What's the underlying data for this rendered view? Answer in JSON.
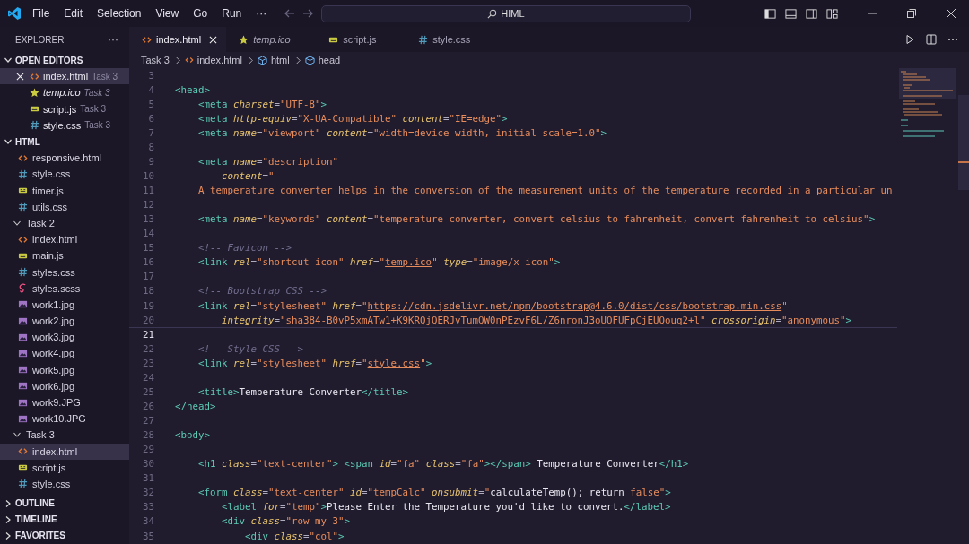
{
  "title_bar": {
    "menu": [
      "File",
      "Edit",
      "Selection",
      "View",
      "Go",
      "Run",
      "···"
    ],
    "search": "HIML"
  },
  "sidebar": {
    "title": "EXPLORER",
    "more": "···",
    "open_editors": {
      "label": "OPEN EDITORS",
      "expanded": true,
      "items": [
        {
          "name": "index.html",
          "kind": "html",
          "description": "Task 3",
          "selected": true,
          "preview": false
        },
        {
          "name": "temp.ico",
          "kind": "ico",
          "description": "Task 3",
          "selected": false,
          "preview": true
        },
        {
          "name": "script.js",
          "kind": "js",
          "description": "Task 3",
          "selected": false,
          "preview": false
        },
        {
          "name": "style.css",
          "kind": "css",
          "description": "Task 3",
          "selected": false,
          "preview": false
        }
      ]
    },
    "folder": {
      "label": "HTML",
      "expanded": true,
      "items": [
        {
          "name": "responsive.html",
          "kind": "html",
          "selected": false
        },
        {
          "name": "style.css",
          "kind": "css",
          "selected": false
        },
        {
          "name": "timer.js",
          "kind": "js",
          "selected": false
        },
        {
          "name": "utils.css",
          "kind": "css",
          "selected": false
        },
        {
          "name": "Task 2",
          "kind": "folder",
          "expanded": true,
          "selected": false,
          "children": [
            {
              "name": "index.html",
              "kind": "html",
              "selected": false
            },
            {
              "name": "main.js",
              "kind": "js",
              "selected": false
            },
            {
              "name": "styles.css",
              "kind": "css",
              "selected": false
            },
            {
              "name": "styles.scss",
              "kind": "scss",
              "selected": false
            },
            {
              "name": "work1.jpg",
              "kind": "image",
              "selected": false
            },
            {
              "name": "work2.jpg",
              "kind": "image",
              "selected": false
            },
            {
              "name": "work3.jpg",
              "kind": "image",
              "selected": false
            },
            {
              "name": "work4.jpg",
              "kind": "image",
              "selected": false
            },
            {
              "name": "work5.jpg",
              "kind": "image",
              "selected": false
            },
            {
              "name": "work6.jpg",
              "kind": "image",
              "selected": false
            },
            {
              "name": "work9.JPG",
              "kind": "image",
              "selected": false
            },
            {
              "name": "work10.JPG",
              "kind": "image",
              "selected": false
            }
          ]
        },
        {
          "name": "Task 3",
          "kind": "folder",
          "expanded": true,
          "selected": false,
          "children": [
            {
              "name": "index.html",
              "kind": "html",
              "selected": true
            },
            {
              "name": "script.js",
              "kind": "js",
              "selected": false
            },
            {
              "name": "style.css",
              "kind": "css",
              "selected": false
            }
          ]
        }
      ]
    },
    "sections": [
      {
        "label": "OUTLINE",
        "expanded": false
      },
      {
        "label": "TIMELINE",
        "expanded": false
      },
      {
        "label": "FAVORITES",
        "expanded": false
      }
    ]
  },
  "tabs": [
    {
      "label": "index.html",
      "kind": "html",
      "selected": true,
      "preview": false
    },
    {
      "label": "temp.ico",
      "kind": "ico",
      "selected": false,
      "preview": true
    },
    {
      "label": "script.js",
      "kind": "js",
      "selected": false,
      "preview": false
    },
    {
      "label": "style.css",
      "kind": "css",
      "selected": false,
      "preview": false
    }
  ],
  "breadcrumbs": [
    {
      "label": "Task 3",
      "kind": "folder"
    },
    {
      "label": "index.html",
      "kind": "html"
    },
    {
      "label": "html",
      "kind": "element"
    },
    {
      "label": "head",
      "kind": "element"
    }
  ],
  "editor": {
    "lines": [
      {
        "number": "3"
      },
      {
        "number": "4",
        "tokens": [
          {
            "kind": "tag",
            "text": "<head>"
          }
        ]
      },
      {
        "number": "5",
        "tokens": [
          {
            "kind": "tag",
            "text": "    <meta "
          },
          {
            "kind": "attr",
            "text": "charset"
          },
          {
            "kind": "punct",
            "text": "="
          },
          {
            "kind": "str",
            "text": "\"UTF-8\""
          },
          {
            "kind": "tag",
            "text": ">"
          }
        ]
      },
      {
        "number": "6",
        "tokens": [
          {
            "kind": "tag",
            "text": "    <meta "
          },
          {
            "kind": "attr",
            "text": "http-equiv"
          },
          {
            "kind": "punct",
            "text": "="
          },
          {
            "kind": "str",
            "text": "\"X-UA-Compatible\" "
          },
          {
            "kind": "attr",
            "text": "content"
          },
          {
            "kind": "punct",
            "text": "="
          },
          {
            "kind": "str",
            "text": "\"IE=edge\""
          },
          {
            "kind": "tag",
            "text": ">"
          }
        ]
      },
      {
        "number": "7",
        "tokens": [
          {
            "kind": "tag",
            "text": "    <meta "
          },
          {
            "kind": "attr",
            "text": "name"
          },
          {
            "kind": "punct",
            "text": "="
          },
          {
            "kind": "str",
            "text": "\"viewport\" "
          },
          {
            "kind": "attr",
            "text": "content"
          },
          {
            "kind": "punct",
            "text": "="
          },
          {
            "kind": "str",
            "text": "\"width=device-width, initial-scale=1.0\""
          },
          {
            "kind": "tag",
            "text": ">"
          }
        ]
      },
      {
        "number": "8"
      },
      {
        "number": "9",
        "tokens": [
          {
            "kind": "tag",
            "text": "    <meta "
          },
          {
            "kind": "attr",
            "text": "name"
          },
          {
            "kind": "punct",
            "text": "="
          },
          {
            "kind": "str",
            "text": "\"description\""
          }
        ]
      },
      {
        "number": "10",
        "tokens": [
          {
            "kind": "attr",
            "text": "        content"
          },
          {
            "kind": "punct",
            "text": "="
          },
          {
            "kind": "str",
            "text": "\""
          }
        ]
      },
      {
        "number": "11",
        "tokens": [
          {
            "kind": "str",
            "text": "    A temperature converter helps in the conversion of the measurement units of the temperature recorded in a particular un"
          }
        ]
      },
      {
        "number": "12"
      },
      {
        "number": "13",
        "tokens": [
          {
            "kind": "tag",
            "text": "    <meta "
          },
          {
            "kind": "attr",
            "text": "name"
          },
          {
            "kind": "punct",
            "text": "="
          },
          {
            "kind": "str",
            "text": "\"keywords\" "
          },
          {
            "kind": "attr",
            "text": "content"
          },
          {
            "kind": "punct",
            "text": "="
          },
          {
            "kind": "str",
            "text": "\"temperature converter, convert celsius to fahrenheit, convert fahrenheit to celsius\""
          },
          {
            "kind": "tag",
            "text": ">"
          }
        ]
      },
      {
        "number": "14"
      },
      {
        "number": "15",
        "tokens": [
          {
            "kind": "comment",
            "text": "    <!-- Favicon -->"
          }
        ]
      },
      {
        "number": "16",
        "tokens": [
          {
            "kind": "tag",
            "text": "    <link "
          },
          {
            "kind": "attr",
            "text": "rel"
          },
          {
            "kind": "punct",
            "text": "="
          },
          {
            "kind": "str",
            "text": "\"shortcut icon\" "
          },
          {
            "kind": "attr",
            "text": "href"
          },
          {
            "kind": "punct",
            "text": "="
          },
          {
            "kind": "str",
            "text": "\""
          },
          {
            "kind": "link",
            "text": "temp.ico"
          },
          {
            "kind": "str",
            "text": "\" "
          },
          {
            "kind": "attr",
            "text": "type"
          },
          {
            "kind": "punct",
            "text": "="
          },
          {
            "kind": "str",
            "text": "\"image/x-icon\""
          },
          {
            "kind": "tag",
            "text": ">"
          }
        ]
      },
      {
        "number": "17"
      },
      {
        "number": "18",
        "tokens": [
          {
            "kind": "comment",
            "text": "    <!-- Bootstrap CSS -->"
          }
        ]
      },
      {
        "number": "19",
        "tokens": [
          {
            "kind": "tag",
            "text": "    <link "
          },
          {
            "kind": "attr",
            "text": "rel"
          },
          {
            "kind": "punct",
            "text": "="
          },
          {
            "kind": "str",
            "text": "\"stylesheet\" "
          },
          {
            "kind": "attr",
            "text": "href"
          },
          {
            "kind": "punct",
            "text": "="
          },
          {
            "kind": "str",
            "text": "\""
          },
          {
            "kind": "link",
            "text": "https://cdn.jsdelivr.net/npm/bootstrap@4.6.0/dist/css/bootstrap.min.css"
          },
          {
            "kind": "str",
            "text": "\""
          }
        ]
      },
      {
        "number": "20",
        "tokens": [
          {
            "kind": "attr",
            "text": "        integrity"
          },
          {
            "kind": "punct",
            "text": "="
          },
          {
            "kind": "str",
            "text": "\"sha384-B0vP5xmATw1+K9KRQjQERJvTumQW0nPEzvF6L/Z6nronJ3oUOFUFpCjEUQouq2+l\" "
          },
          {
            "kind": "attr",
            "text": "crossorigin"
          },
          {
            "kind": "punct",
            "text": "="
          },
          {
            "kind": "str",
            "text": "\"anonymous\""
          },
          {
            "kind": "tag",
            "text": ">"
          }
        ]
      },
      {
        "number": "21",
        "current": true
      },
      {
        "number": "22",
        "tokens": [
          {
            "kind": "comment",
            "text": "    <!-- Style CSS -->"
          }
        ]
      },
      {
        "number": "23",
        "tokens": [
          {
            "kind": "tag",
            "text": "    <link "
          },
          {
            "kind": "attr",
            "text": "rel"
          },
          {
            "kind": "punct",
            "text": "="
          },
          {
            "kind": "str",
            "text": "\"stylesheet\" "
          },
          {
            "kind": "attr",
            "text": "href"
          },
          {
            "kind": "punct",
            "text": "="
          },
          {
            "kind": "str",
            "text": "\""
          },
          {
            "kind": "link",
            "text": "style.css"
          },
          {
            "kind": "str",
            "text": "\""
          },
          {
            "kind": "tag",
            "text": ">"
          }
        ]
      },
      {
        "number": "24"
      },
      {
        "number": "25",
        "tokens": [
          {
            "kind": "tag",
            "text": "    <title>"
          },
          {
            "kind": "text",
            "text": "Temperature Converter"
          },
          {
            "kind": "tag",
            "text": "</title>"
          }
        ]
      },
      {
        "number": "26",
        "tokens": [
          {
            "kind": "tag",
            "text": "</head>"
          }
        ]
      },
      {
        "number": "27"
      },
      {
        "number": "28",
        "tokens": [
          {
            "kind": "tag",
            "text": "<body>"
          }
        ]
      },
      {
        "number": "29"
      },
      {
        "number": "30",
        "tokens": [
          {
            "kind": "tag",
            "text": "    <h1 "
          },
          {
            "kind": "attr",
            "text": "class"
          },
          {
            "kind": "punct",
            "text": "="
          },
          {
            "kind": "str",
            "text": "\"text-center\""
          },
          {
            "kind": "tag",
            "text": "> <span "
          },
          {
            "kind": "attr",
            "text": "id"
          },
          {
            "kind": "punct",
            "text": "="
          },
          {
            "kind": "str",
            "text": "\"fa\" "
          },
          {
            "kind": "attr",
            "text": "class"
          },
          {
            "kind": "punct",
            "text": "="
          },
          {
            "kind": "str",
            "text": "\"fa\""
          },
          {
            "kind": "tag",
            "text": "></span>"
          },
          {
            "kind": "text",
            "text": " Temperature Converter"
          },
          {
            "kind": "tag",
            "text": "</h1>"
          }
        ]
      },
      {
        "number": "31"
      },
      {
        "number": "32",
        "tokens": [
          {
            "kind": "tag",
            "text": "    <form "
          },
          {
            "kind": "attr",
            "text": "class"
          },
          {
            "kind": "punct",
            "text": "="
          },
          {
            "kind": "str",
            "text": "\"text-center\" "
          },
          {
            "kind": "attr",
            "text": "id"
          },
          {
            "kind": "punct",
            "text": "="
          },
          {
            "kind": "str",
            "text": "\"tempCalc\" "
          },
          {
            "kind": "attr",
            "text": "onsubmit"
          },
          {
            "kind": "punct",
            "text": "="
          },
          {
            "kind": "str",
            "text": "\""
          },
          {
            "kind": "text",
            "text": "calculateTemp(); return "
          },
          {
            "kind": "str",
            "text": "false\""
          },
          {
            "kind": "tag",
            "text": ">"
          }
        ]
      },
      {
        "number": "33",
        "tokens": [
          {
            "kind": "tag",
            "text": "        <label "
          },
          {
            "kind": "attr",
            "text": "for"
          },
          {
            "kind": "punct",
            "text": "="
          },
          {
            "kind": "str",
            "text": "\"temp\""
          },
          {
            "kind": "tag",
            "text": ">"
          },
          {
            "kind": "text",
            "text": "Please Enter the Temperature you'd like to convert."
          },
          {
            "kind": "tag",
            "text": "</label>"
          }
        ]
      },
      {
        "number": "34",
        "tokens": [
          {
            "kind": "tag",
            "text": "        <div "
          },
          {
            "kind": "attr",
            "text": "class"
          },
          {
            "kind": "punct",
            "text": "="
          },
          {
            "kind": "str",
            "text": "\"row my-3\""
          },
          {
            "kind": "tag",
            "text": ">"
          }
        ]
      },
      {
        "number": "35",
        "tokens": [
          {
            "kind": "tag",
            "text": "            <div "
          },
          {
            "kind": "attr",
            "text": "class"
          },
          {
            "kind": "punct",
            "text": "="
          },
          {
            "kind": "str",
            "text": "\"col\""
          },
          {
            "kind": "tag",
            "text": ">"
          }
        ]
      }
    ]
  }
}
